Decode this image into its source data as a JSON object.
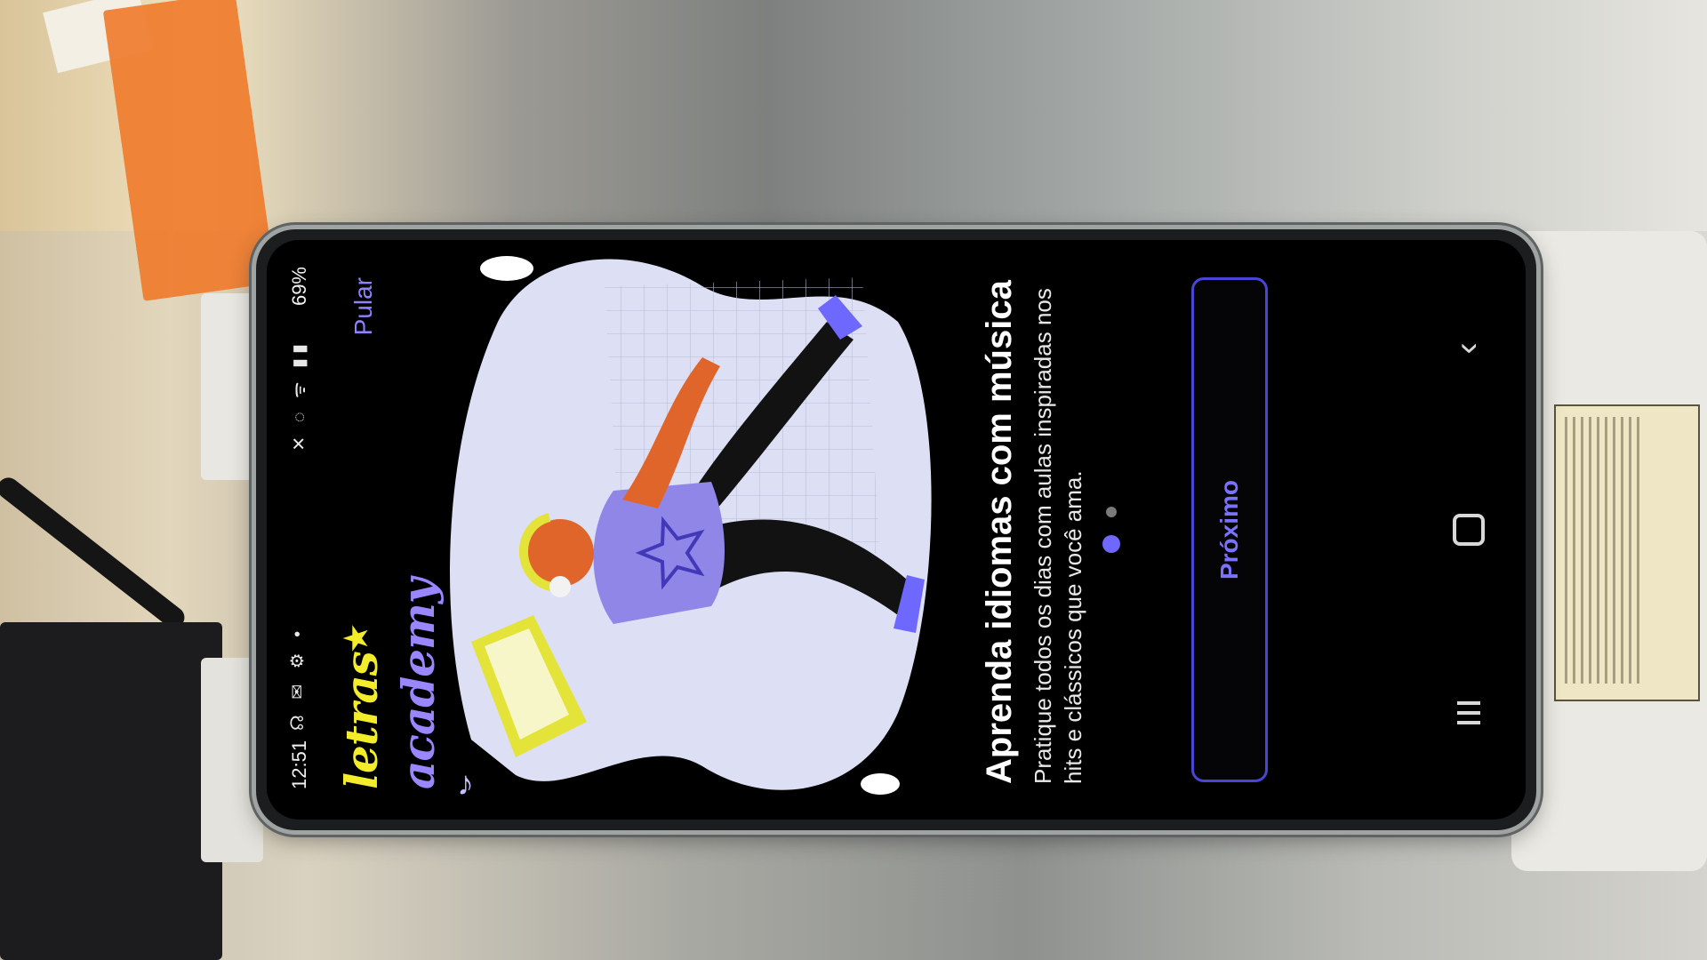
{
  "status_bar": {
    "time": "12:51",
    "left_icons": "☊ ✉ ⚙ •",
    "right_icons": "✕ ◌ ᯤ ▮▮",
    "battery": "69%"
  },
  "app": {
    "logo_word1": "letras",
    "logo_star": "★",
    "logo_word2": "academy",
    "skip_label": "Pular",
    "note_icon": "♪"
  },
  "onboarding": {
    "title": "Aprenda idiomas com música",
    "subtitle": "Pratique todos os dias com aulas inspiradas nos hits e clássicos que você ama.",
    "next_label": "Próximo",
    "page_index": 1,
    "page_count": 2
  },
  "navbar": {
    "back_glyph": "‹"
  },
  "colors": {
    "accent": "#7a72ff",
    "logo_yellow": "#f2ec2a",
    "logo_purple": "#9a86ff",
    "background": "#000000"
  }
}
